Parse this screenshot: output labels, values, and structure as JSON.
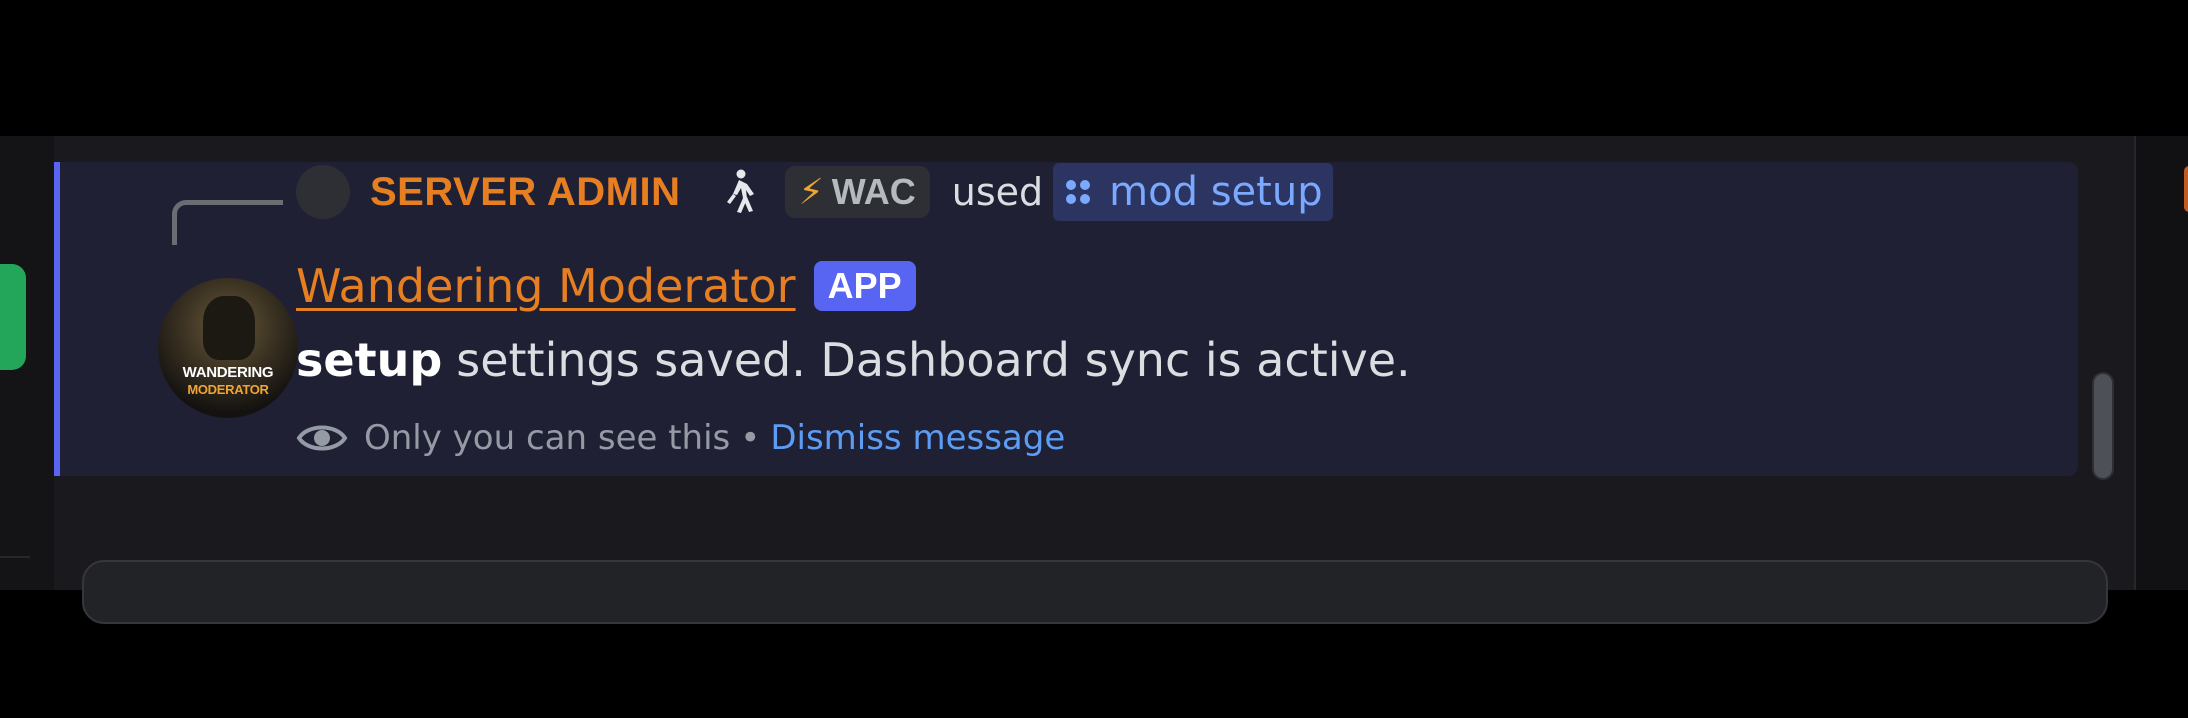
{
  "reply": {
    "author": "SERVER ADMIN",
    "tag": "WAC",
    "used_text": "used",
    "command": "mod setup"
  },
  "bot": {
    "name": "Wandering Moderator",
    "badge": "APP",
    "avatar_line1": "WANDERING",
    "avatar_line2": "MODERATOR"
  },
  "message": {
    "command_word": "setup",
    "text": "settings saved. Dashboard sync is active."
  },
  "ephemeral": {
    "notice": "Only you can see this",
    "separator": "•",
    "dismiss_label": "Dismiss message"
  },
  "icons": {
    "reply_avatar": "avatar-placeholder",
    "walk": "person-walking-icon",
    "tag": "lightning-bolt-icon",
    "command": "app-command-icon",
    "ephemeral": "eye-icon"
  },
  "colors": {
    "accent": "#5865f2",
    "author": "#e67e22",
    "link": "#5c9cf5",
    "command_chip_bg": "#2c3561",
    "message_bg": "#1f2033",
    "status_online": "#23a55a"
  }
}
